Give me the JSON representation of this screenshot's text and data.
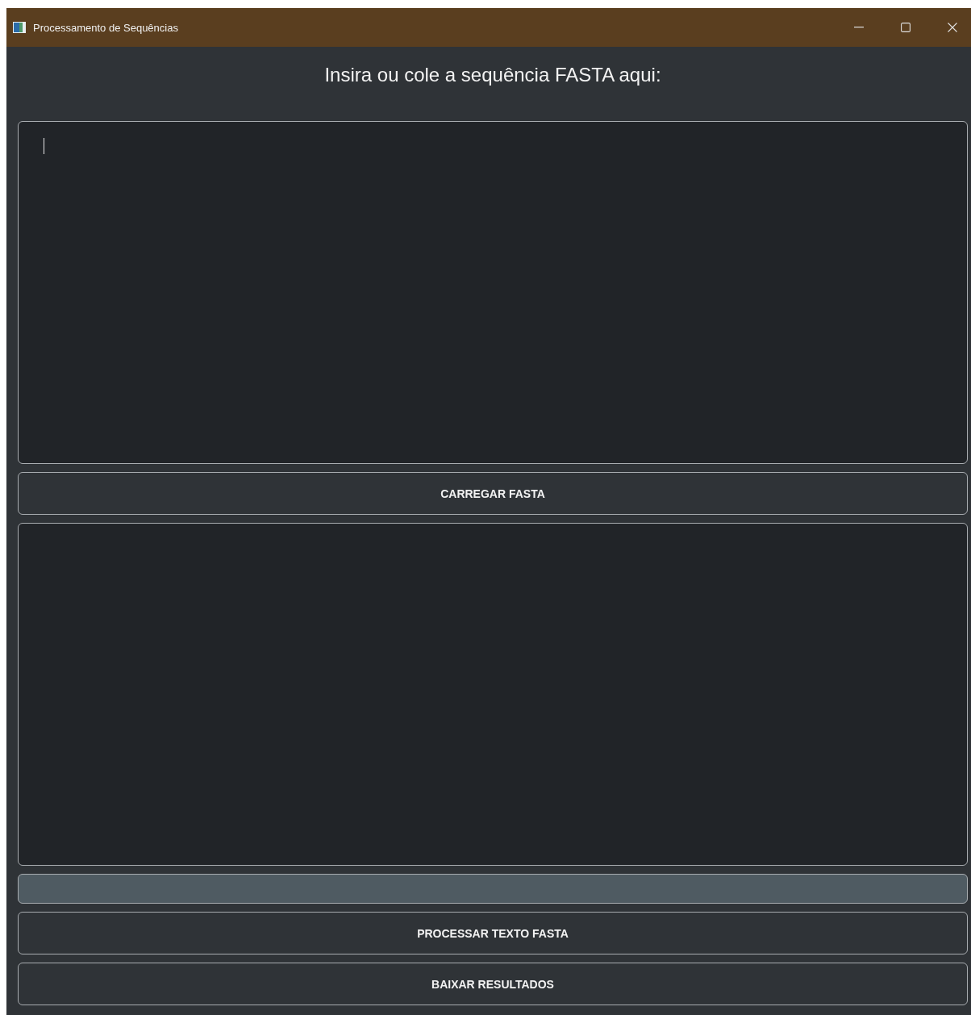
{
  "window": {
    "title": "Processamento de Sequências"
  },
  "heading": "Insira ou cole a sequência FASTA aqui:",
  "input_area": {
    "focused": true
  },
  "load_button": {
    "label": "CARREGAR FASTA"
  },
  "progress": {
    "level": 0
  },
  "buttons": [
    {
      "label": "PROCESSAR TEXTO FASTA"
    },
    {
      "label": "BAIXAR RESULTADOS"
    }
  ]
}
